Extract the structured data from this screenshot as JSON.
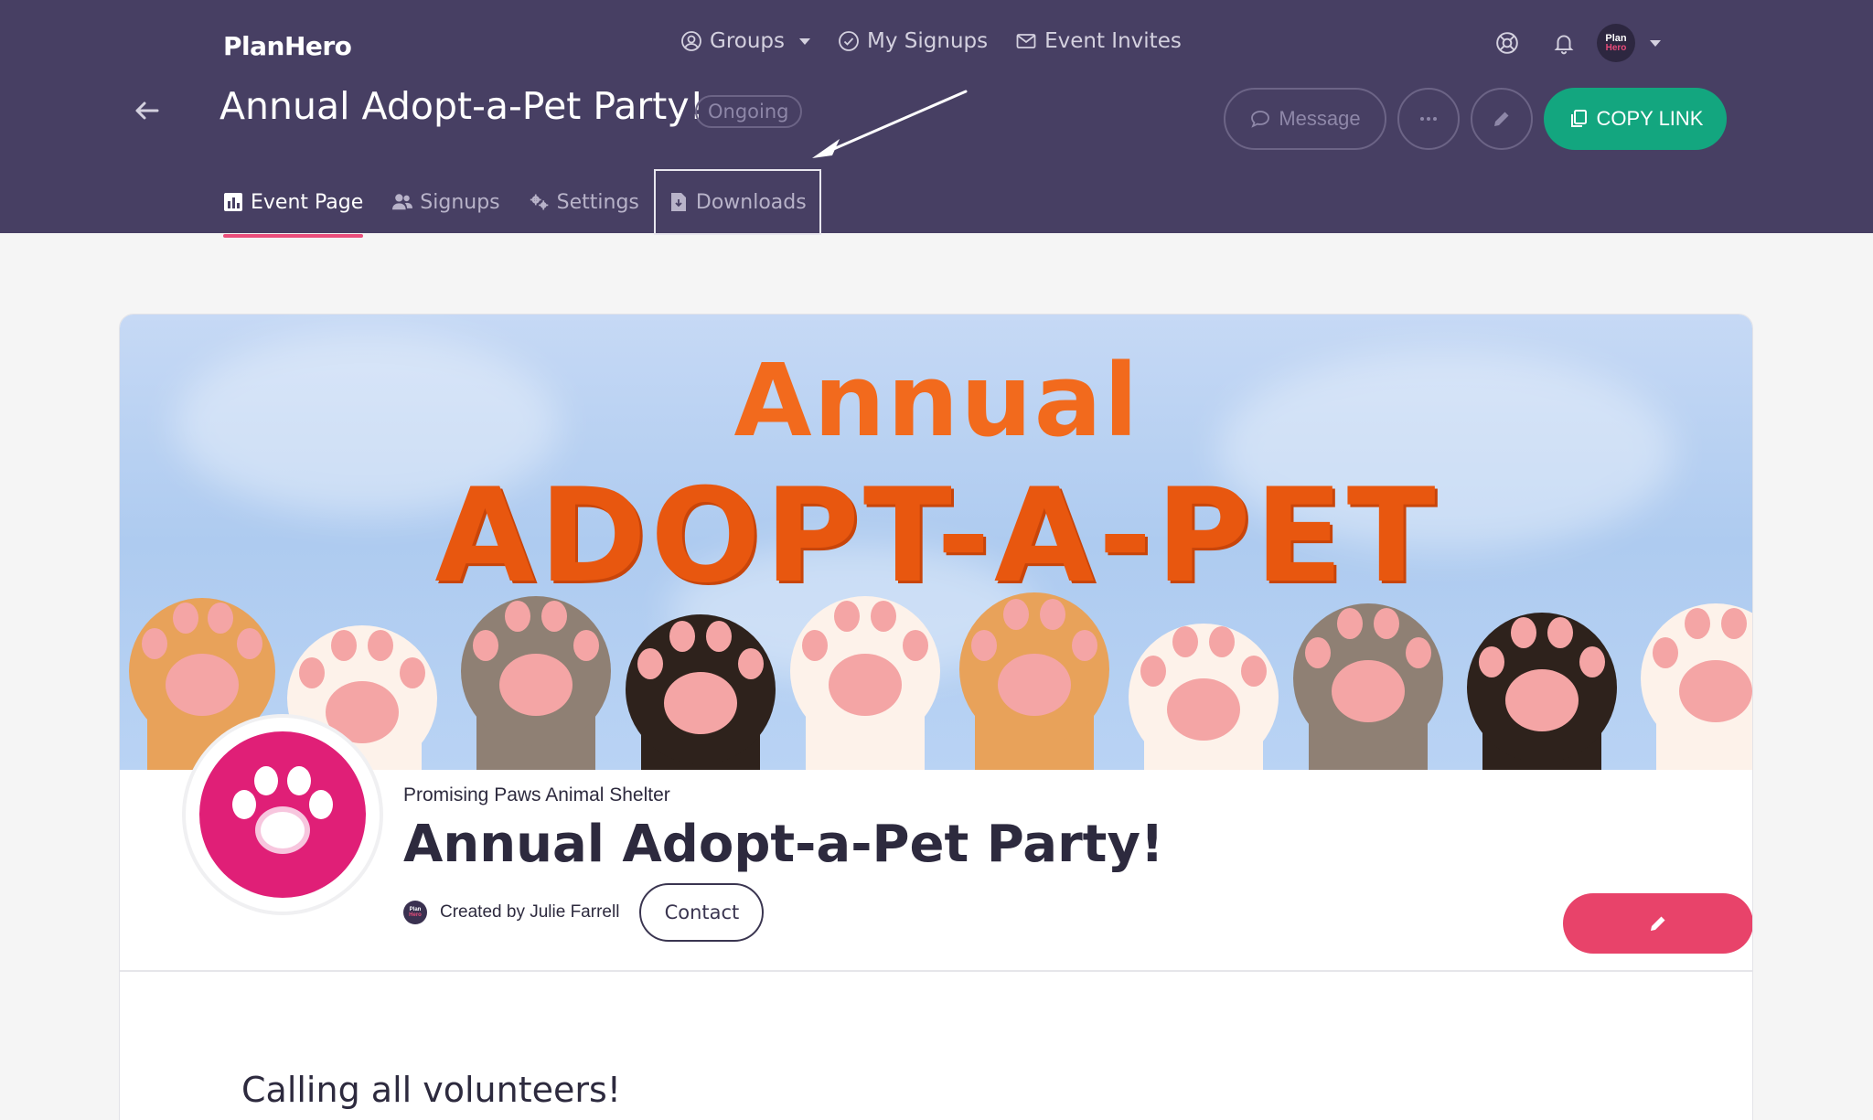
{
  "app": {
    "logo": "PlanHero"
  },
  "topnav": {
    "groups": "Groups",
    "my_signups": "My Signups",
    "event_invites": "Event Invites"
  },
  "user_avatar": {
    "line1": "Plan",
    "line2": "Hero"
  },
  "event": {
    "title": "Annual Adopt-a-Pet Party!",
    "status": "Ongoing"
  },
  "actions": {
    "message": "Message",
    "copy_link": "COPY LINK"
  },
  "tabs": [
    {
      "label": "Event Page",
      "active": true
    },
    {
      "label": "Signups",
      "active": false
    },
    {
      "label": "Settings",
      "active": false
    },
    {
      "label": "Downloads",
      "active": false,
      "highlighted": true
    }
  ],
  "banner": {
    "line1": "Annual",
    "line2": "ADOPT-A-PET"
  },
  "card": {
    "organization": "Promising Paws Animal Shelter",
    "title": "Annual Adopt-a-Pet Party!",
    "created_by": "Created by Julie Farrell",
    "contact": "Contact",
    "creator_avatar": {
      "line1": "Plan",
      "line2": "Hero"
    }
  },
  "content": {
    "heading": "Calling all volunteers!"
  },
  "colors": {
    "header_bg": "#473f63",
    "accent_pink": "#ea4e7b",
    "copy_green": "#13a67f",
    "profile_pink": "#e01f77",
    "banner_orange": "#e8570f"
  }
}
